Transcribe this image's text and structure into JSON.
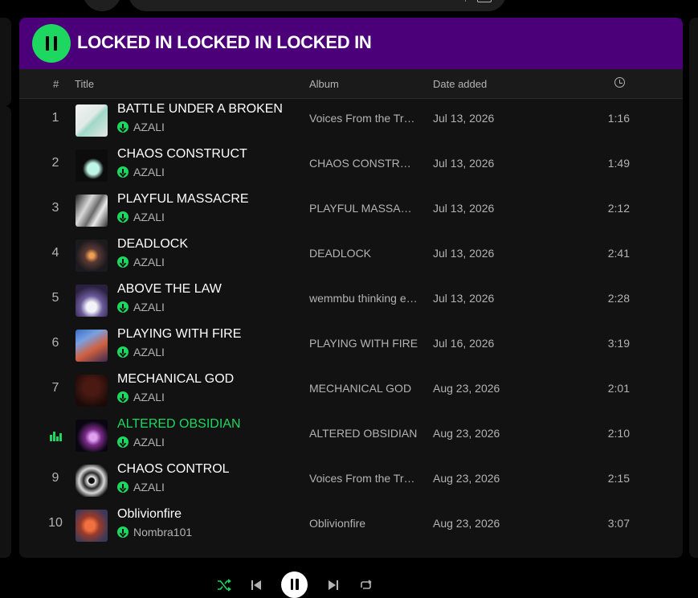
{
  "playlist": {
    "title": "LOCKED IN LOCKED IN LOCKED IN"
  },
  "columns": {
    "index": "#",
    "title": "Title",
    "album": "Album",
    "date_added": "Date added",
    "duration_icon": "clock-icon"
  },
  "tracks": [
    {
      "num": "1",
      "title": "BATTLE UNDER A BROKEN …",
      "artist": "AZALI",
      "album": "Voices From the Tru…",
      "date": "Jul 13, 2026",
      "duration": "1:16",
      "playing": false
    },
    {
      "num": "2",
      "title": "CHAOS CONSTRUCT",
      "artist": "AZALI",
      "album": "CHAOS CONSTRUCT",
      "date": "Jul 13, 2026",
      "duration": "1:49",
      "playing": false
    },
    {
      "num": "3",
      "title": "PLAYFUL MASSACRE",
      "artist": "AZALI",
      "album": "PLAYFUL MASSACRE",
      "date": "Jul 13, 2026",
      "duration": "2:12",
      "playing": false
    },
    {
      "num": "4",
      "title": "DEADLOCK",
      "artist": "AZALI",
      "album": "DEADLOCK",
      "date": "Jul 13, 2026",
      "duration": "2:41",
      "playing": false
    },
    {
      "num": "5",
      "title": "ABOVE THE LAW",
      "artist": "AZALI",
      "album": "wemmbu thinking e…",
      "date": "Jul 13, 2026",
      "duration": "2:28",
      "playing": false
    },
    {
      "num": "6",
      "title": "PLAYING WITH FIRE",
      "artist": "AZALI",
      "album": "PLAYING WITH FIRE",
      "date": "Jul 16, 2026",
      "duration": "3:19",
      "playing": false
    },
    {
      "num": "7",
      "title": "MECHANICAL GOD",
      "artist": "AZALI",
      "album": "MECHANICAL GOD",
      "date": "Aug 23, 2026",
      "duration": "2:01",
      "playing": false
    },
    {
      "num": "8",
      "title": "ALTERED OBSIDIAN",
      "artist": "AZALI",
      "album": "ALTERED OBSIDIAN",
      "date": "Aug 23, 2026",
      "duration": "2:10",
      "playing": true
    },
    {
      "num": "9",
      "title": "CHAOS CONTROL",
      "artist": "AZALI",
      "album": "Voices From the Tru…",
      "date": "Aug 23, 2026",
      "duration": "2:15",
      "playing": false
    },
    {
      "num": "10",
      "title": "Oblivionfire",
      "artist": "Nombra101",
      "album": "Oblivionfire",
      "date": "Aug 23, 2026",
      "duration": "3:07",
      "playing": false
    }
  ],
  "colors": {
    "header_bg": "#4b007a",
    "accent": "#1ed760",
    "panel_bg": "#121212",
    "muted_text": "#b3b3b3"
  },
  "player_controls": [
    "shuffle-icon",
    "previous-icon",
    "pause-icon",
    "next-icon",
    "repeat-icon"
  ]
}
